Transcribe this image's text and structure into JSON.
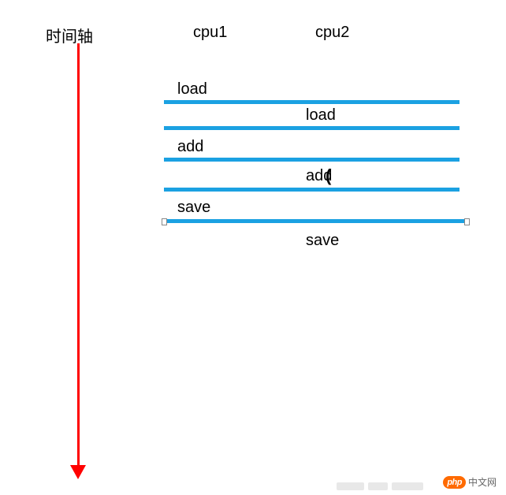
{
  "axis_label": "时间轴",
  "headers": {
    "cpu1": "cpu1",
    "cpu2": "cpu2"
  },
  "rows": {
    "r1": "load",
    "r2": "load",
    "r3": "add",
    "r4": "add",
    "r5": "save",
    "r6": "save"
  },
  "logo": {
    "badge": "php",
    "text": "中文网"
  },
  "colors": {
    "arrow": "#ff0000",
    "bar": "#1ba1e2",
    "logo_badge": "#ff6a00"
  },
  "chart_data": {
    "type": "table",
    "title": "时间轴",
    "columns": [
      "cpu1",
      "cpu2"
    ],
    "sequence": [
      {
        "step": 1,
        "cpu1": "load",
        "cpu2": ""
      },
      {
        "step": 2,
        "cpu1": "",
        "cpu2": "load"
      },
      {
        "step": 3,
        "cpu1": "add",
        "cpu2": ""
      },
      {
        "step": 4,
        "cpu1": "",
        "cpu2": "add"
      },
      {
        "step": 5,
        "cpu1": "save",
        "cpu2": ""
      },
      {
        "step": 6,
        "cpu1": "",
        "cpu2": "save"
      }
    ]
  }
}
